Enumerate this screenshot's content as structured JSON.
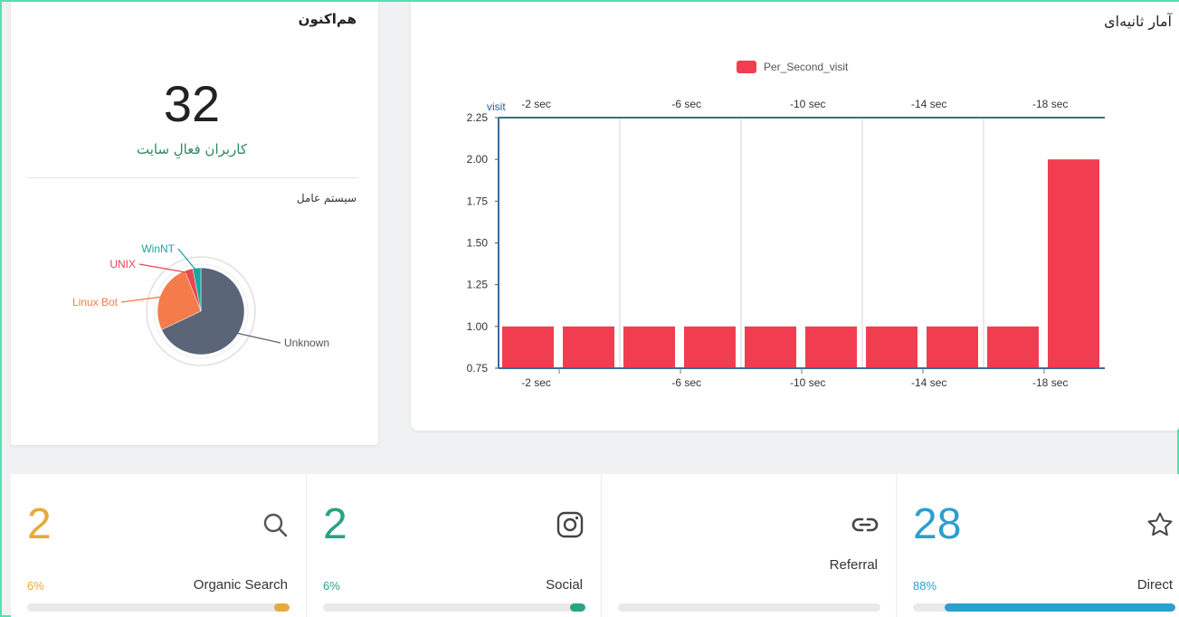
{
  "now_card": {
    "title": "هم‌اکنون",
    "active_users": "32",
    "active_users_label": "کاربران فعالِ سایت",
    "os_title": "سیستم عامل",
    "os_pie": {
      "slices": [
        {
          "name": "Unknown",
          "value": 68,
          "color": "#5a6577"
        },
        {
          "name": "Linux Bot",
          "value": 26,
          "color": "#f47c4a"
        },
        {
          "name": "UNIX",
          "value": 3,
          "color": "#e8474f"
        },
        {
          "name": "WinNT",
          "value": 3,
          "color": "#1aa5a5"
        }
      ]
    }
  },
  "stats_card": {
    "title": "آمار ثانیه‌ای"
  },
  "chart_data": {
    "type": "bar",
    "title": "",
    "ylabel": "visit",
    "ylim": [
      0.75,
      2.25
    ],
    "yticks": [
      "0.75",
      "1.00",
      "1.25",
      "1.50",
      "1.75",
      "2.00",
      "2.25"
    ],
    "tick_labels": [
      "-2 sec",
      "-6 sec",
      "-10 sec",
      "-14 sec",
      "-18 sec"
    ],
    "series": [
      {
        "name": "Per_Second_visit",
        "color": "#f03e50",
        "values": [
          1,
          1,
          1,
          1,
          1,
          1,
          1,
          1,
          1,
          2
        ]
      }
    ],
    "grid": true,
    "legend": "top"
  },
  "metrics": [
    {
      "value": "2",
      "percent": "6%",
      "label": "Organic Search",
      "color": "#e8a93b",
      "progress": 0.06,
      "icon": "search-icon"
    },
    {
      "value": "2",
      "percent": "6%",
      "label": "Social",
      "color": "#27a385",
      "progress": 0.06,
      "icon": "instagram-icon"
    },
    {
      "value": "",
      "percent": "",
      "label": "Referral",
      "color": "#5c6b73",
      "progress": 0,
      "icon": "link-icon"
    },
    {
      "value": "28",
      "percent": "88%",
      "label": "Direct",
      "color": "#2b9fd0",
      "progress": 0.88,
      "icon": "star-icon"
    }
  ]
}
